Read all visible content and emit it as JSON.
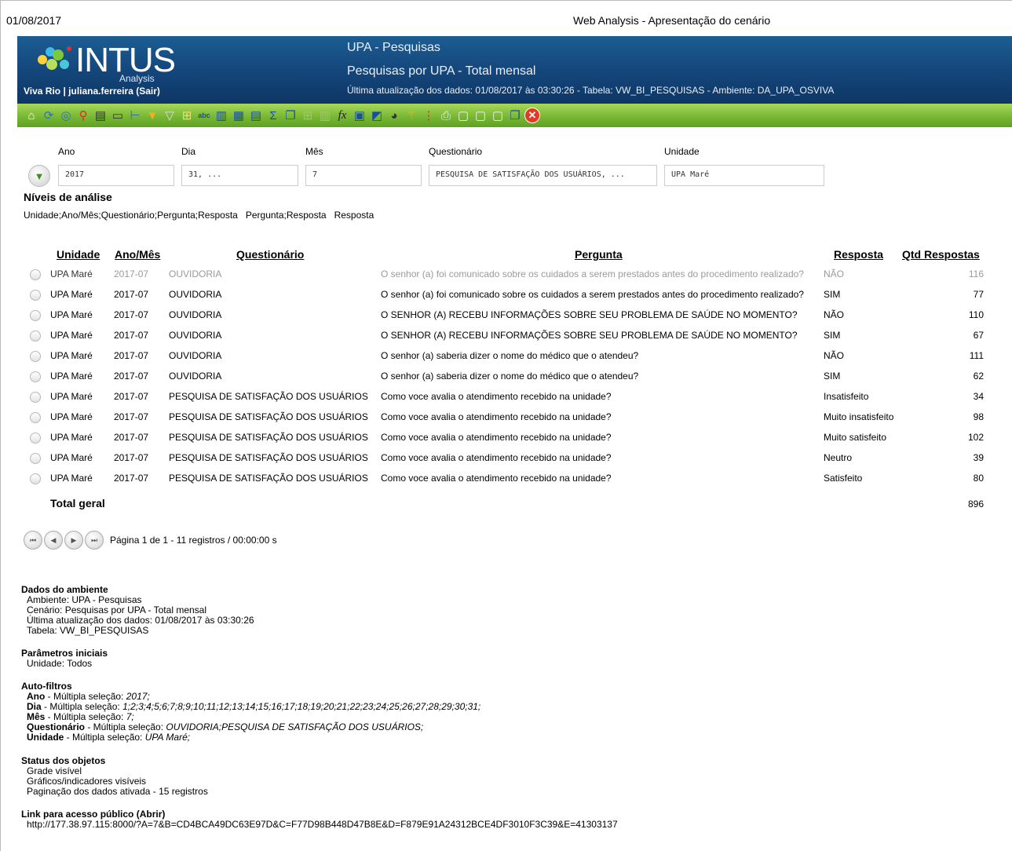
{
  "top": {
    "date": "01/08/2017",
    "title": "Web Analysis - Apresentação do cenário"
  },
  "banner": {
    "logo_text": "INTUS",
    "logo_sub": "Analysis",
    "user": "Viva Rio | juliana.ferreira",
    "sair": "(Sair)",
    "environment": "UPA - Pesquisas",
    "scenario": "Pesquisas por UPA - Total mensal",
    "update_line": "Última atualização dos dados: 01/08/2017 às 03:30:26 - Tabela: VW_BI_PESQUISAS - Ambiente: DA_UPA_OSVIVA",
    "colors": {
      "banner": "#14457a",
      "toolbar": "#78b835"
    }
  },
  "toolbar": {
    "icons": [
      "home-icon",
      "refresh-icon",
      "zoom-icon",
      "pin-icon",
      "chart-edit-icon",
      "presentation-icon",
      "hierarchy-icon",
      "filter-icon",
      "filter-clear-icon",
      "pivot-icon",
      "spellcheck-icon",
      "columns-icon",
      "grid-icon",
      "table-icon",
      "sum-icon",
      "window-icon",
      "blank-grid-icon",
      "bar-chart-icon",
      "formula-icon",
      "dashboard-icon",
      "line-chart-icon",
      "gauge-icon",
      "tree-icon",
      "indicator-icon",
      "print-icon",
      "export-excel-icon",
      "export-word-icon",
      "export-pdf-icon",
      "window-restore-icon",
      "close-icon"
    ]
  },
  "filters": {
    "ano": {
      "label": "Ano",
      "value": "2017"
    },
    "dia": {
      "label": "Dia",
      "value": "31, ..."
    },
    "mes": {
      "label": "Mês",
      "value": "7"
    },
    "questionario": {
      "label": "Questionário",
      "value": "PESQUISA DE SATISFAÇÃO DOS USUÁRIOS, ..."
    },
    "unidade": {
      "label": "Unidade",
      "value": "UPA Maré"
    }
  },
  "niveis": {
    "title": "Níveis de análise",
    "items": [
      "Unidade;Ano/Mês;Questionário;Pergunta;Resposta",
      "Pergunta;Resposta",
      "Resposta"
    ]
  },
  "table": {
    "headers": {
      "unidade": "Unidade",
      "anomes": "Ano/Mês",
      "questionario": "Questionário",
      "pergunta": "Pergunta",
      "resposta": "Resposta",
      "qtd": "Qtd Respostas"
    },
    "rows": [
      {
        "unidade": "UPA Maré",
        "anomes": "2017-07",
        "questionario": "OUVIDORIA",
        "pergunta": "O senhor (a) foi comunicado sobre os cuidados a serem prestados antes do procedimento realizado?",
        "resposta": "NÃO",
        "qtd": "116"
      },
      {
        "unidade": "UPA Maré",
        "anomes": "2017-07",
        "questionario": "OUVIDORIA",
        "pergunta": "O senhor (a) foi comunicado sobre os cuidados a serem prestados antes do procedimento realizado?",
        "resposta": "SIM",
        "qtd": "77"
      },
      {
        "unidade": "UPA Maré",
        "anomes": "2017-07",
        "questionario": "OUVIDORIA",
        "pergunta": "O SENHOR (A) RECEBU INFORMAÇÕES SOBRE SEU PROBLEMA DE SAÚDE NO MOMENTO?",
        "resposta": "NÃO",
        "qtd": "110"
      },
      {
        "unidade": "UPA Maré",
        "anomes": "2017-07",
        "questionario": "OUVIDORIA",
        "pergunta": "O SENHOR (A) RECEBU INFORMAÇÕES SOBRE SEU PROBLEMA DE SAÚDE NO MOMENTO?",
        "resposta": "SIM",
        "qtd": "67"
      },
      {
        "unidade": "UPA Maré",
        "anomes": "2017-07",
        "questionario": "OUVIDORIA",
        "pergunta": "O senhor (a) saberia dizer o nome do médico que o atendeu?",
        "resposta": "NÃO",
        "qtd": "111"
      },
      {
        "unidade": "UPA Maré",
        "anomes": "2017-07",
        "questionario": "OUVIDORIA",
        "pergunta": "O senhor (a) saberia dizer o nome do médico que o atendeu?",
        "resposta": "SIM",
        "qtd": "62"
      },
      {
        "unidade": "UPA Maré",
        "anomes": "2017-07",
        "questionario": "PESQUISA DE SATISFAÇÃO DOS USUÁRIOS",
        "pergunta": "Como voce avalia o atendimento recebido na unidade?",
        "resposta": "Insatisfeito",
        "qtd": "34"
      },
      {
        "unidade": "UPA Maré",
        "anomes": "2017-07",
        "questionario": "PESQUISA DE SATISFAÇÃO DOS USUÁRIOS",
        "pergunta": "Como voce avalia o atendimento recebido na unidade?",
        "resposta": "Muito insatisfeito",
        "qtd": "98"
      },
      {
        "unidade": "UPA Maré",
        "anomes": "2017-07",
        "questionario": "PESQUISA DE SATISFAÇÃO DOS USUÁRIOS",
        "pergunta": "Como voce avalia o atendimento recebido na unidade?",
        "resposta": "Muito satisfeito",
        "qtd": "102"
      },
      {
        "unidade": "UPA Maré",
        "anomes": "2017-07",
        "questionario": "PESQUISA DE SATISFAÇÃO DOS USUÁRIOS",
        "pergunta": "Como voce avalia o atendimento recebido na unidade?",
        "resposta": "Neutro",
        "qtd": "39"
      },
      {
        "unidade": "UPA Maré",
        "anomes": "2017-07",
        "questionario": "PESQUISA DE SATISFAÇÃO DOS USUÁRIOS",
        "pergunta": "Como voce avalia o atendimento recebido na unidade?",
        "resposta": "Satisfeito",
        "qtd": "80"
      }
    ],
    "total_label": "Total geral",
    "total_value": "896"
  },
  "pager": {
    "text": "Página 1 de 1 - 11 registros / 00:00:00 s"
  },
  "info": {
    "dados": {
      "title": "Dados do ambiente",
      "lines": [
        "Ambiente: UPA - Pesquisas",
        "Cenário: Pesquisas por UPA - Total mensal",
        "Última atualização dos dados: 01/08/2017 às 03:30:26",
        "Tabela: VW_BI_PESQUISAS"
      ]
    },
    "parametros": {
      "title": "Parâmetros iniciais",
      "lines": [
        "Unidade: Todos"
      ]
    },
    "autofiltros": {
      "title": "Auto-filtros",
      "items": [
        {
          "field": "Ano",
          "mode": " - Múltipla seleção: ",
          "value": "2017;"
        },
        {
          "field": "Dia",
          "mode": " - Múltipla seleção: ",
          "value": "1;2;3;4;5;6;7;8;9;10;11;12;13;14;15;16;17;18;19;20;21;22;23;24;25;26;27;28;29;30;31;"
        },
        {
          "field": "Mês",
          "mode": " - Múltipla seleção: ",
          "value": "7;"
        },
        {
          "field": "Questionário",
          "mode": " - Múltipla seleção: ",
          "value": "OUVIDORIA;PESQUISA DE SATISFAÇÃO DOS USUÁRIOS;"
        },
        {
          "field": "Unidade",
          "mode": " - Múltipla seleção: ",
          "value": "UPA Maré;"
        }
      ]
    },
    "status": {
      "title": "Status dos objetos",
      "lines": [
        "Grade visível",
        "Gráficos/indicadores visíveis",
        "Paginação dos dados ativada - 15 registros"
      ]
    },
    "link": {
      "title": "Link para acesso público (Abrir)",
      "url": "http://177.38.97.115:8000/?A=7&B=CD4BCA49DC63E97D&C=F77D98B448D47B8E&D=F879E91A24312BCE4DF3010F3C39&E=41303137"
    }
  }
}
